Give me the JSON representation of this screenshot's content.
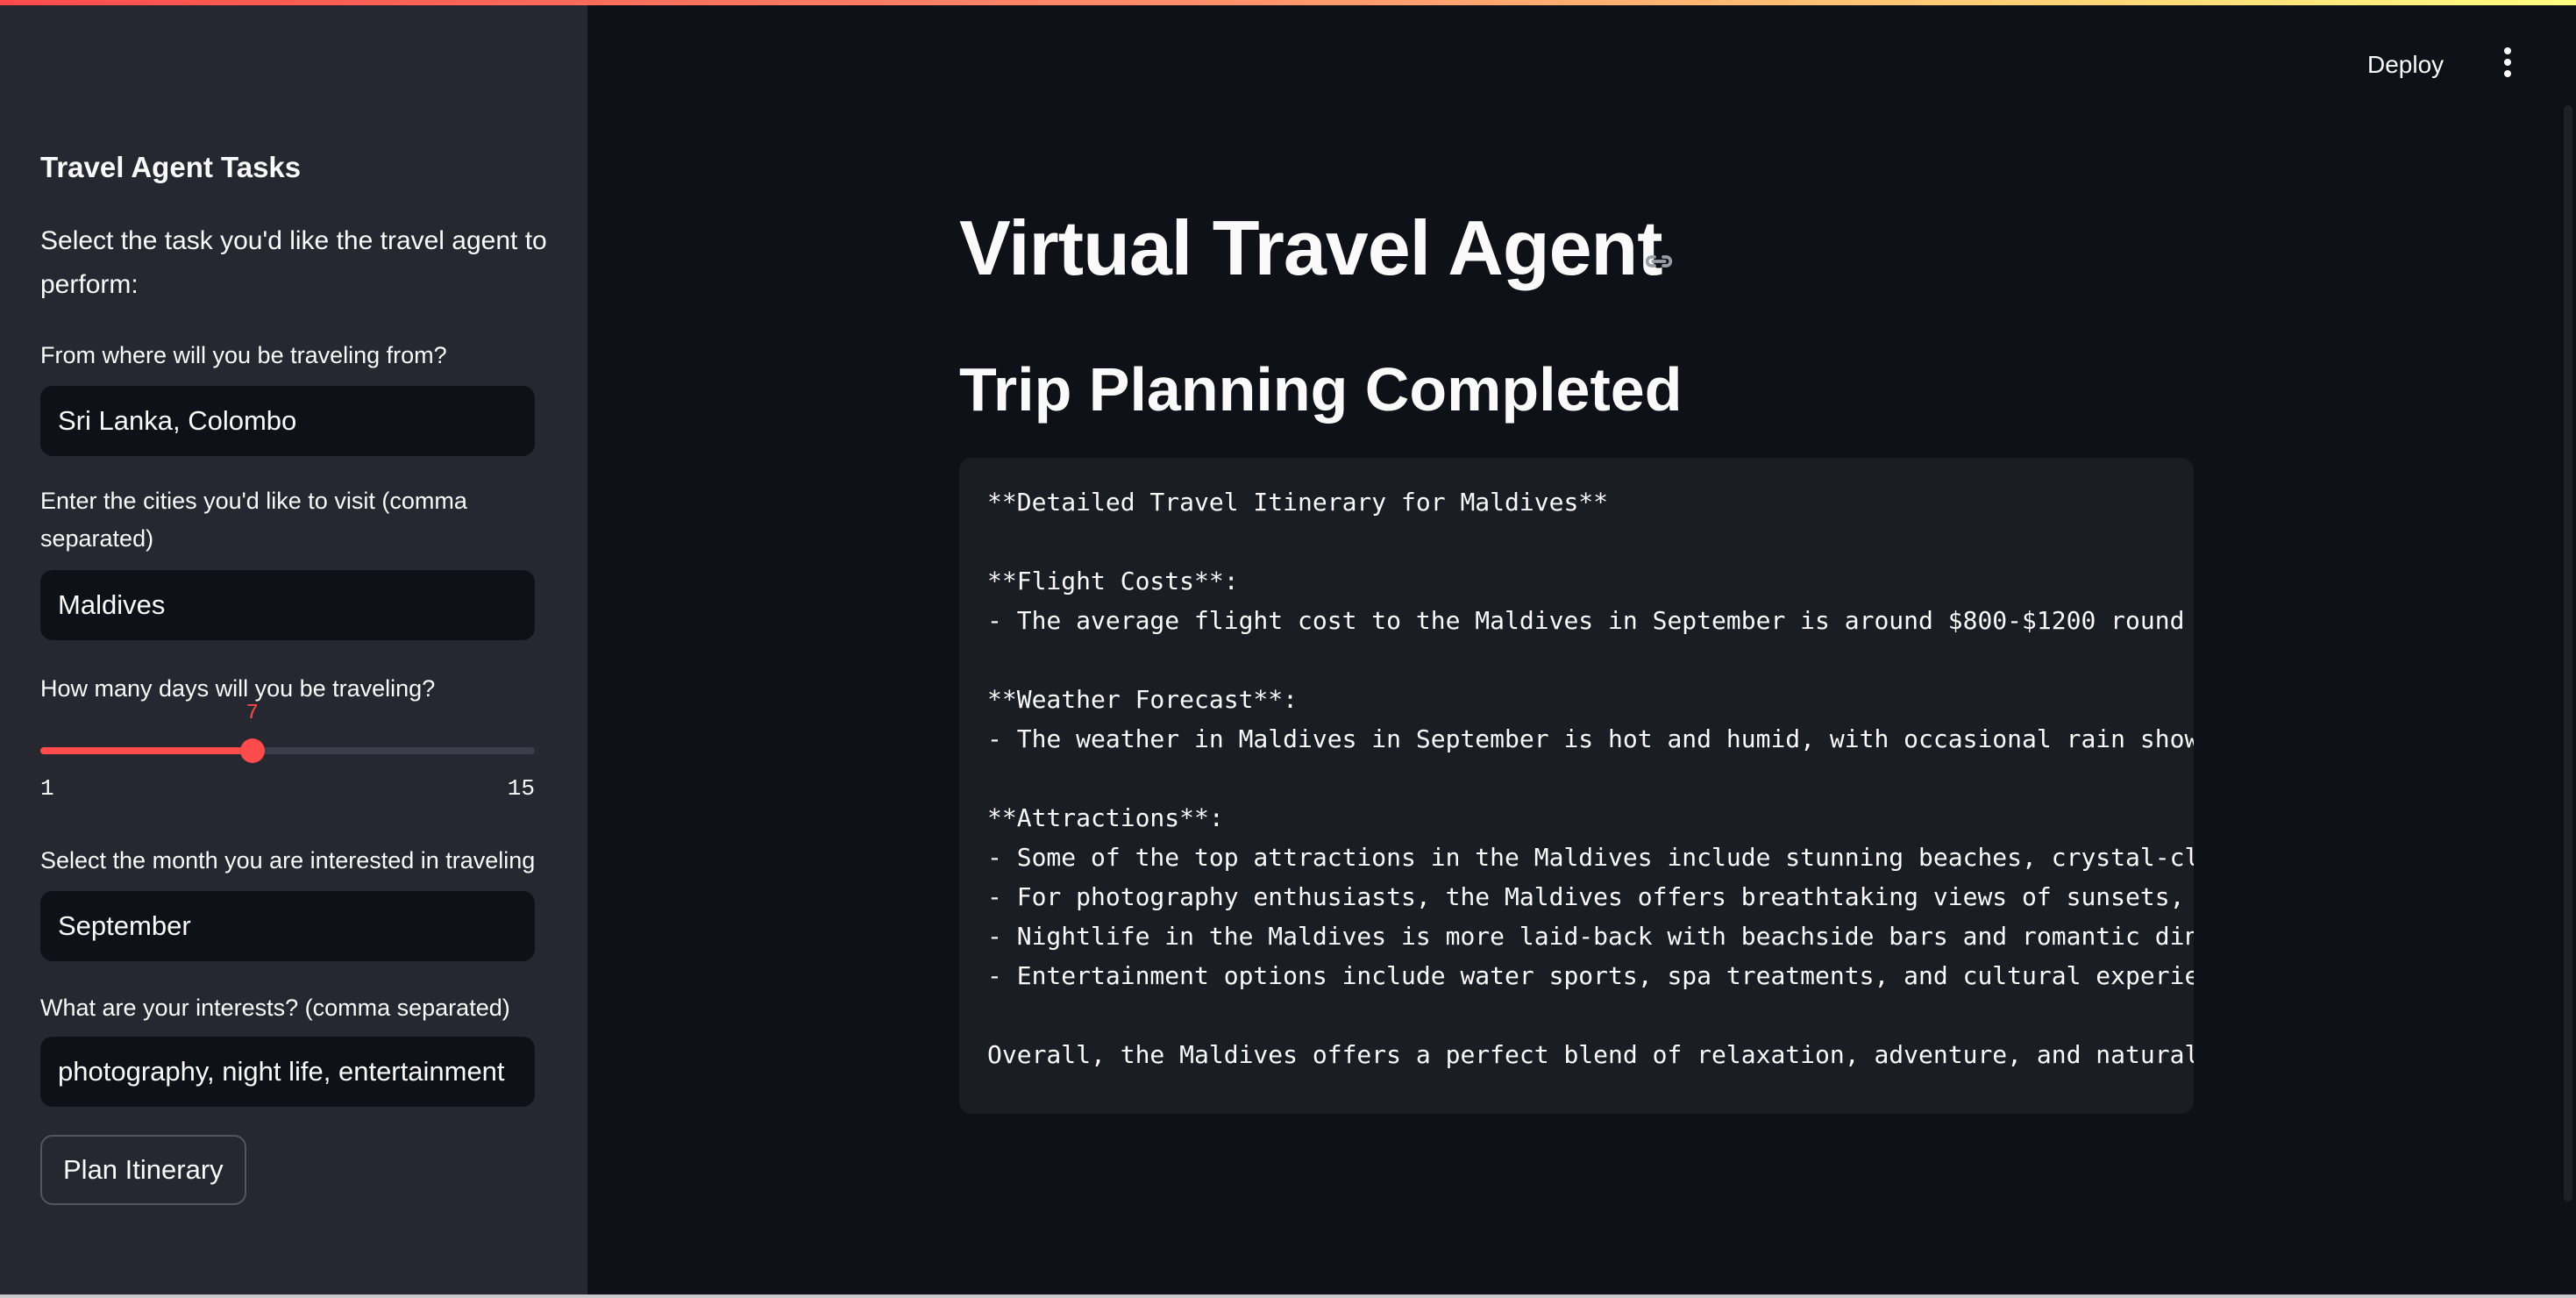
{
  "header": {
    "deploy_label": "Deploy",
    "menu_icon": "more-vertical-icon"
  },
  "sidebar": {
    "title": "Travel Agent Tasks",
    "description": "Select the task you'd like the travel agent to perform:",
    "origin": {
      "label": "From where will you be traveling from?",
      "value": "Sri Lanka, Colombo"
    },
    "cities": {
      "label": "Enter the cities you'd like to visit (comma separated)",
      "value": "Maldives"
    },
    "days": {
      "label": "How many days will you be traveling?",
      "value": 7,
      "min": 1,
      "max": 15
    },
    "month": {
      "label": "Select the month you are interested in traveling",
      "value": "September"
    },
    "interests": {
      "label": "What are your interests? (comma separated)",
      "value": "photography, night life, entertainment"
    },
    "plan_button": "Plan Itinerary"
  },
  "main": {
    "title": "Virtual Travel Agent",
    "subtitle": "Trip Planning Completed",
    "itinerary_lines": [
      "**Detailed Travel Itinerary for Maldives**",
      "",
      "**Flight Costs**:",
      "- The average flight cost to the Maldives in September is around $800-$1200 round",
      "",
      "**Weather Forecast**:",
      "- The weather in Maldives in September is hot and humid, with occasional rain show",
      "",
      "**Attractions**:",
      "- Some of the top attractions in the Maldives include stunning beaches, crystal-cl",
      "- For photography enthusiasts, the Maldives offers breathtaking views of sunsets,",
      "- Nightlife in the Maldives is more laid-back with beachside bars and romantic din",
      "- Entertainment options include water sports, spa treatments, and cultural experie",
      "",
      "Overall, the Maldives offers a perfect blend of relaxation, adventure, and natural"
    ]
  },
  "colors": {
    "accent": "#ff4b4b",
    "sidebar_bg": "#262730",
    "main_bg": "#0e1117",
    "code_bg": "#1b1d25"
  }
}
